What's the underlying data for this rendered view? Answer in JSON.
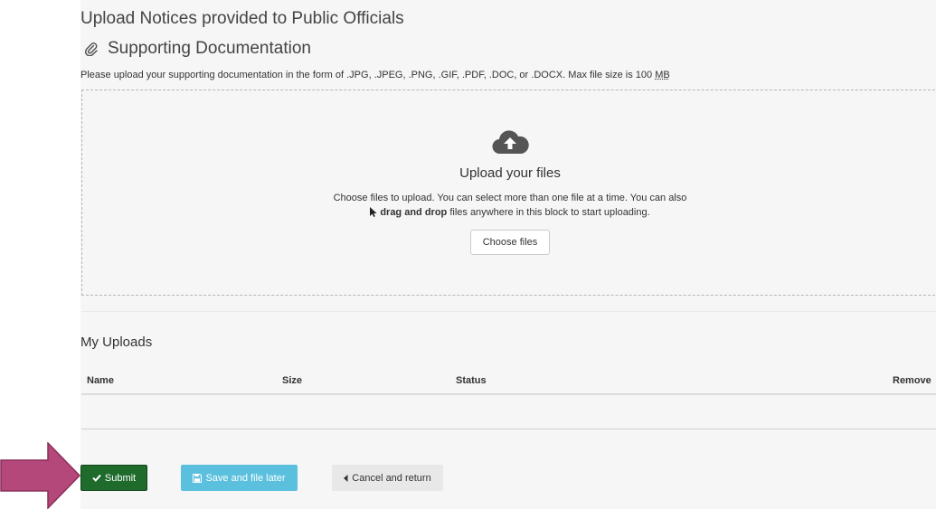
{
  "page": {
    "title": "Upload Notices provided to Public Officials"
  },
  "section": {
    "title": "Supporting Documentation",
    "icon": "paperclip-icon",
    "instructions": "Please upload your supporting documentation in the form of .JPG, .JPEG, .PNG, .GIF, .PDF, .DOC, or .DOCX. Max file size is 100",
    "size_unit": "MB"
  },
  "dropzone": {
    "icon": "cloud-upload-icon",
    "heading": "Upload your files",
    "line1": "Choose files to upload. You can select more than one file at a time. You can also",
    "line2_bold": "drag and drop",
    "line2_rest": " files anywhere in this block to start uploading.",
    "choose_button": "Choose files"
  },
  "uploads": {
    "title": "My Uploads",
    "columns": [
      "Name",
      "Size",
      "Status",
      "Remove"
    ],
    "rows": []
  },
  "actions": {
    "submit": "Submit",
    "save": "Save and file later",
    "cancel": "Cancel and return"
  },
  "colors": {
    "submit_bg": "#1e6b2c",
    "save_bg": "#5bc0de",
    "cancel_bg": "#e8e8e8",
    "arrow_fill": "#b5487a",
    "panel_bg": "#f6f6f6"
  }
}
